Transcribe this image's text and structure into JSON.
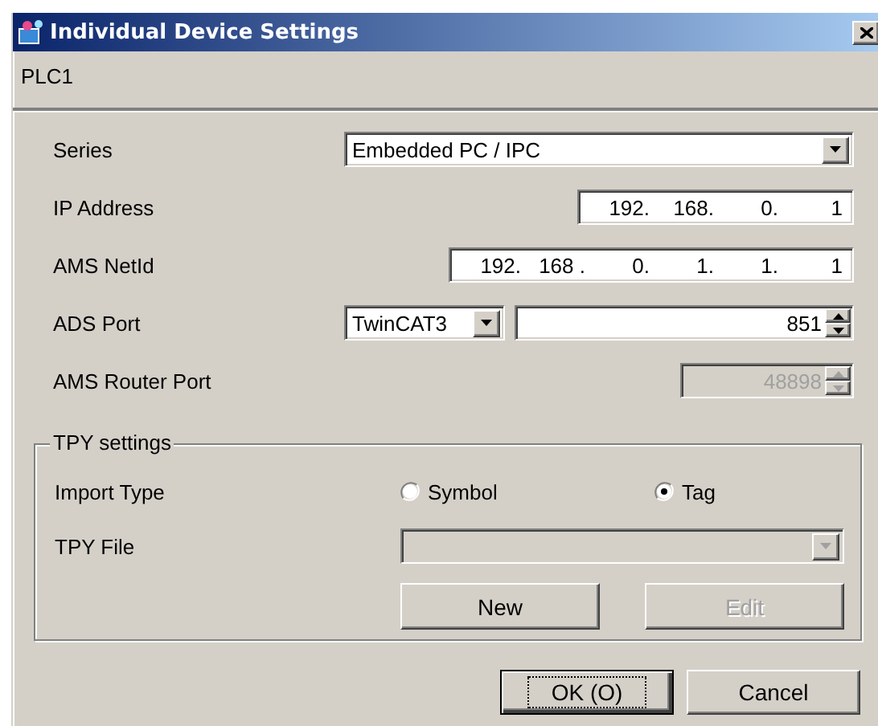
{
  "window": {
    "title": "Individual Device Settings"
  },
  "device": "PLC1",
  "fields": [
    {
      "kind": "dropdown",
      "label": "Series",
      "value": "Embedded PC / IPC",
      "disabled": false
    },
    {
      "kind": "ip",
      "label": "IP Address",
      "octets": [
        "192.",
        "168.",
        "0.",
        "1"
      ],
      "disabled": false
    },
    {
      "kind": "ip",
      "label": "AMS NetId",
      "octets": [
        "192.",
        "168 .",
        "0.",
        "1.",
        "1.",
        "1"
      ],
      "disabled": false
    },
    {
      "kind": "combo-spin",
      "label": "ADS Port",
      "option": "TwinCAT3",
      "value": "851",
      "disabled": false
    },
    {
      "kind": "spin",
      "label": "AMS Router Port",
      "value": "48898",
      "disabled": true
    }
  ],
  "tpy": {
    "title": "TPY settings",
    "import_type": {
      "label": "Import Type",
      "options": [
        {
          "label": "Symbol",
          "selected": false
        },
        {
          "label": "Tag",
          "selected": true
        }
      ]
    },
    "file": {
      "label": "TPY File",
      "disabled": true
    },
    "buttons": [
      {
        "label": "New",
        "disabled": false
      },
      {
        "label": "Edit",
        "disabled": true
      }
    ]
  },
  "buttons": [
    {
      "label": "OK (O)",
      "default": true
    },
    {
      "label": "Cancel",
      "default": false
    }
  ]
}
